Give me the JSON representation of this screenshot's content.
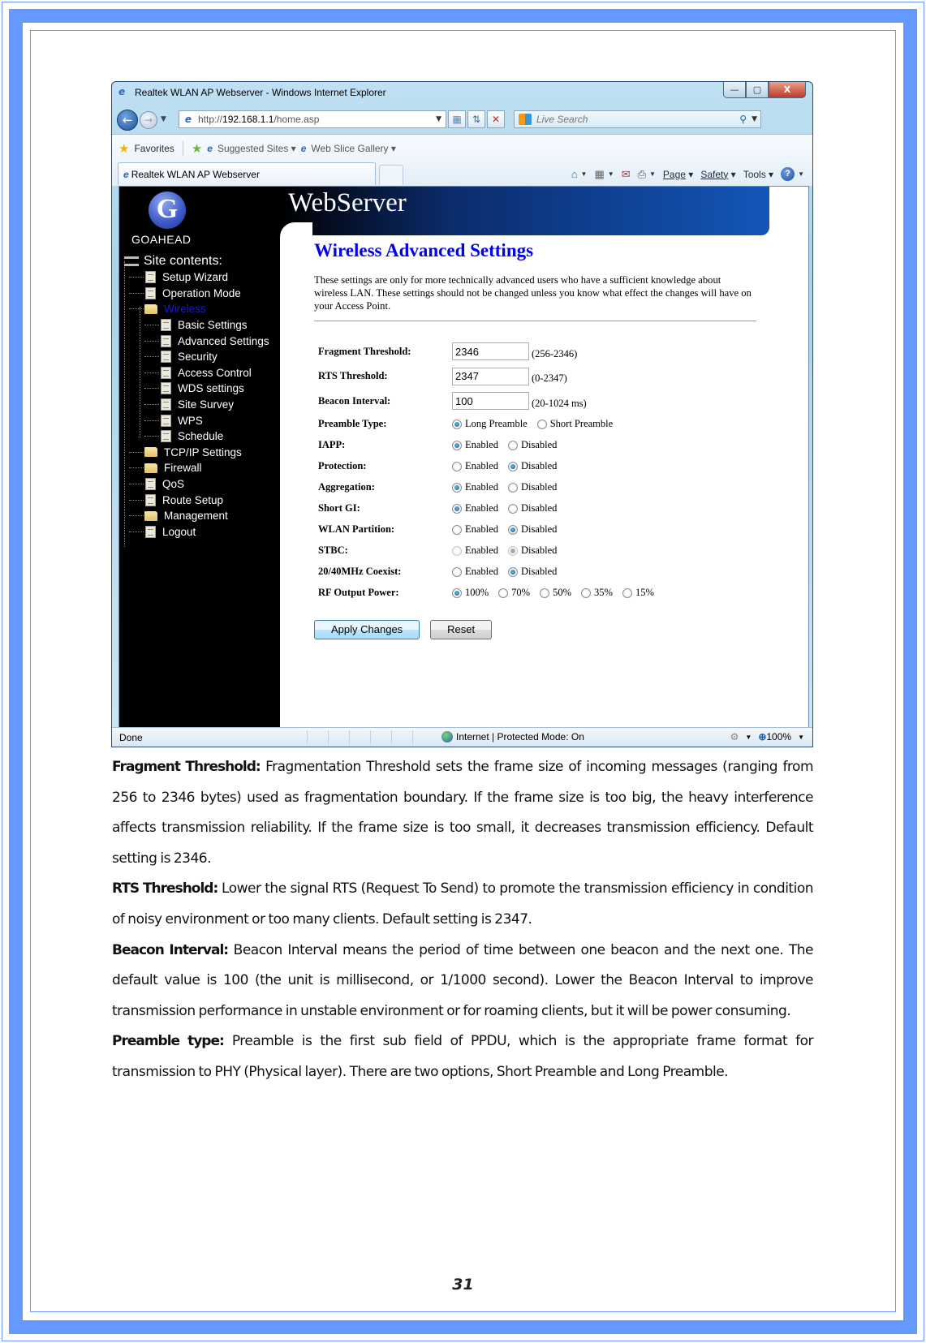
{
  "browser": {
    "window_title": "Realtek WLAN AP Webserver - Windows Internet Explorer",
    "window_controls": {
      "minimize": "—",
      "maximize": "▢",
      "close": "X"
    },
    "address": {
      "prefix": "http://",
      "host": "192.168.1.1",
      "path": "/home.asp"
    },
    "search_placeholder": "Live Search",
    "favorites_bar": {
      "favorites_label": "Favorites",
      "links": [
        {
          "label": "Suggested Sites ▾"
        },
        {
          "label": "Web Slice Gallery ▾"
        }
      ]
    },
    "tab_title": "Realtek WLAN AP Webserver",
    "command_bar": {
      "page": "Page",
      "safety": "Safety",
      "tools": "Tools"
    },
    "status": {
      "text": "Done",
      "zone": "Internet | Protected Mode: On",
      "zoom": "100%"
    }
  },
  "webserver": {
    "logo_letter": "G",
    "logo_text": "GOAHEAD",
    "banner_title": "WebServer",
    "tree_root": "Site contents:",
    "tree": [
      {
        "label": "Setup Wizard",
        "type": "doc",
        "level": 1
      },
      {
        "label": "Operation Mode",
        "type": "doc",
        "level": 1
      },
      {
        "label": "Wireless",
        "type": "folder-open",
        "level": 1,
        "active": true
      },
      {
        "label": "Basic Settings",
        "type": "doc",
        "level": 2
      },
      {
        "label": "Advanced Settings",
        "type": "doc",
        "level": 2
      },
      {
        "label": "Security",
        "type": "doc",
        "level": 2
      },
      {
        "label": "Access Control",
        "type": "doc",
        "level": 2
      },
      {
        "label": "WDS settings",
        "type": "doc",
        "level": 2
      },
      {
        "label": "Site Survey",
        "type": "doc",
        "level": 2
      },
      {
        "label": "WPS",
        "type": "doc",
        "level": 2
      },
      {
        "label": "Schedule",
        "type": "doc",
        "level": 2
      },
      {
        "label": "TCP/IP Settings",
        "type": "folder",
        "level": 1
      },
      {
        "label": "Firewall",
        "type": "folder",
        "level": 1
      },
      {
        "label": "QoS",
        "type": "doc",
        "level": 1
      },
      {
        "label": "Route Setup",
        "type": "doc",
        "level": 1
      },
      {
        "label": "Management",
        "type": "folder",
        "level": 1
      },
      {
        "label": "Logout",
        "type": "doc",
        "level": 1
      }
    ],
    "page_title": "Wireless Advanced Settings",
    "intro": "These settings are only for more technically advanced users who have a sufficient knowledge about wireless LAN. These settings should not be changed unless you know what effect the changes will have on your Access Point.",
    "text_fields": [
      {
        "label": "Fragment Threshold:",
        "value": "2346",
        "range": "(256-2346)"
      },
      {
        "label": "RTS Threshold:",
        "value": "2347",
        "range": "(0-2347)"
      },
      {
        "label": "Beacon Interval:",
        "value": "100",
        "range": "(20-1024 ms)"
      }
    ],
    "radio_fields": [
      {
        "label": "Preamble Type:",
        "options": [
          {
            "label": "Long Preamble",
            "checked": true
          },
          {
            "label": "Short Preamble",
            "checked": false
          }
        ]
      },
      {
        "label": "IAPP:",
        "options": [
          {
            "label": "Enabled",
            "checked": true
          },
          {
            "label": "Disabled",
            "checked": false
          }
        ]
      },
      {
        "label": "Protection:",
        "options": [
          {
            "label": "Enabled",
            "checked": false
          },
          {
            "label": "Disabled",
            "checked": true
          }
        ]
      },
      {
        "label": "Aggregation:",
        "options": [
          {
            "label": "Enabled",
            "checked": true
          },
          {
            "label": "Disabled",
            "checked": false
          }
        ]
      },
      {
        "label": "Short GI:",
        "options": [
          {
            "label": "Enabled",
            "checked": true
          },
          {
            "label": "Disabled",
            "checked": false
          }
        ]
      },
      {
        "label": "WLAN Partition:",
        "options": [
          {
            "label": "Enabled",
            "checked": false
          },
          {
            "label": "Disabled",
            "checked": true
          }
        ]
      },
      {
        "label": "STBC:",
        "disabled": true,
        "options": [
          {
            "label": "Enabled",
            "checked": false
          },
          {
            "label": "Disabled",
            "checked": true
          }
        ]
      },
      {
        "label": "20/40MHz Coexist:",
        "options": [
          {
            "label": "Enabled",
            "checked": false
          },
          {
            "label": "Disabled",
            "checked": true
          }
        ]
      },
      {
        "label": "RF Output Power:",
        "options": [
          {
            "label": "100%",
            "checked": true
          },
          {
            "label": "70%",
            "checked": false
          },
          {
            "label": "50%",
            "checked": false
          },
          {
            "label": "35%",
            "checked": false
          },
          {
            "label": "15%",
            "checked": false
          }
        ]
      }
    ],
    "apply_button": "Apply Changes",
    "reset_button": "Reset"
  },
  "document": {
    "paragraphs": [
      {
        "term": "Fragment Threshold:",
        "text": " Fragmentation Threshold sets the frame size of incoming messages (ranging from 256 to 2346 bytes) used as fragmentation boundary. If the frame size is too big, the heavy interference affects transmission reliability. If the frame size is too small, it decreases transmission efficiency. Default setting is 2346."
      },
      {
        "term": "RTS Threshold:",
        "text": " Lower the signal RTS (Request To Send) to promote the transmission efficiency in condition of noisy environment or too many clients. Default setting is 2347."
      },
      {
        "term": "Beacon Interval:",
        "text": " Beacon Interval means the period of time between one beacon and the next one. The default value is 100 (the unit is millisecond, or 1/1000 second). Lower the Beacon Interval to improve transmission performance in unstable environment or for roaming clients, but it will be power consuming."
      },
      {
        "term": "Preamble type:",
        "text": " Preamble is the first sub field of PPDU, which is the appropriate frame format for transmission to PHY (Physical layer). There are two options, Short Preamble and Long Preamble."
      }
    ],
    "page_number": "31"
  },
  "colors": {
    "frame": "#6699ff",
    "heading": "#0000ee",
    "active_tree_item": "#1a1ad6"
  }
}
